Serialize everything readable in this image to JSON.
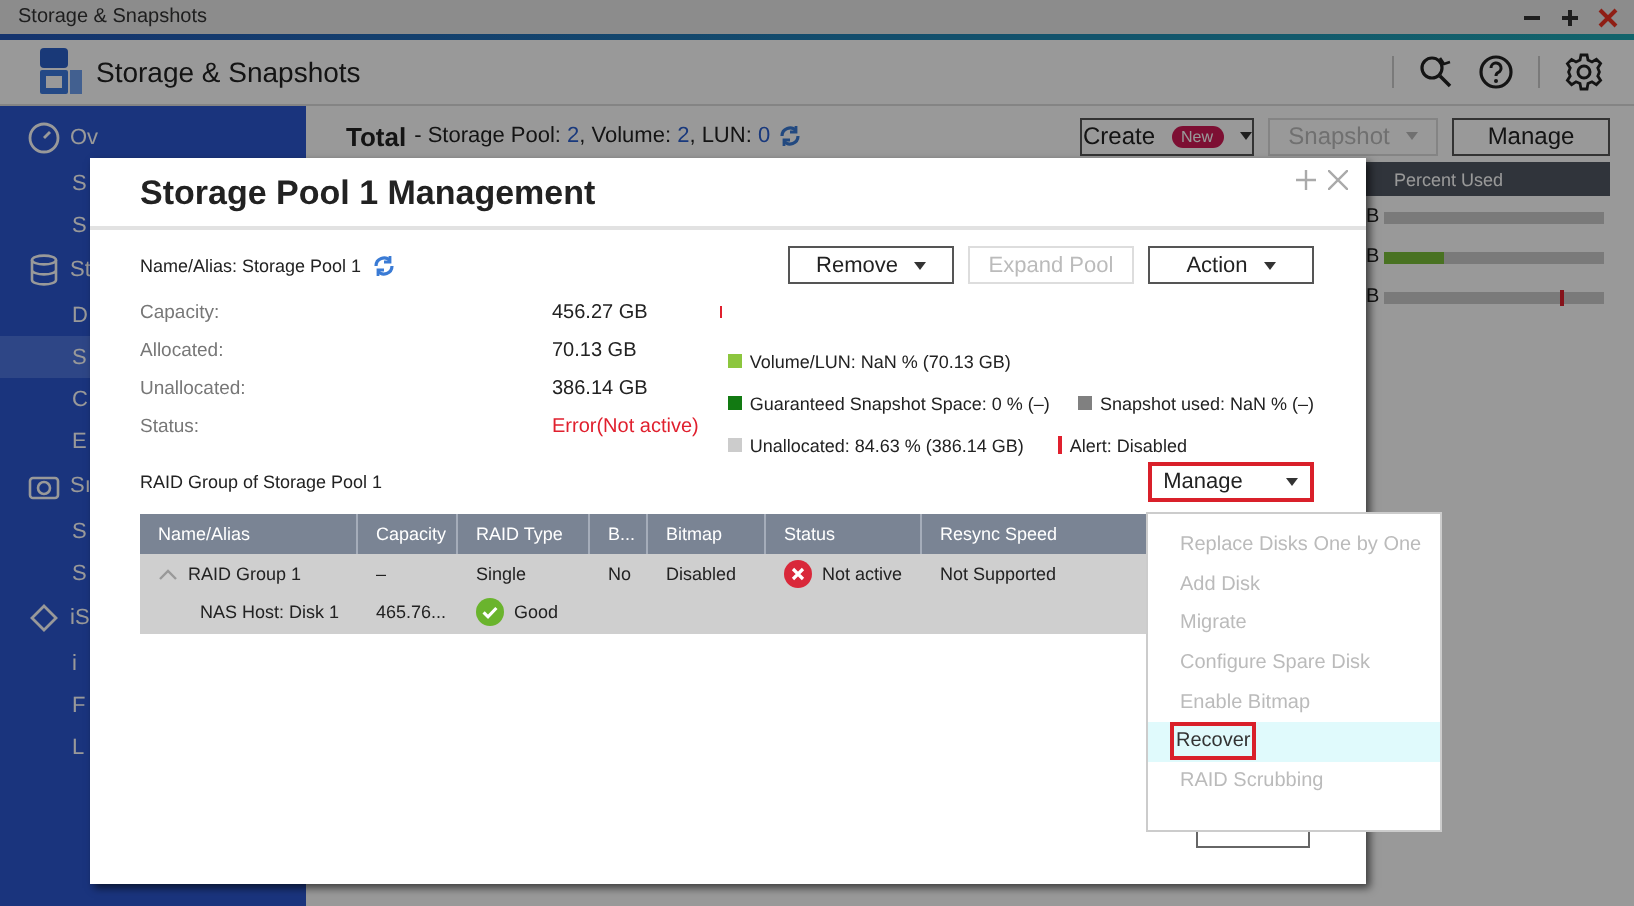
{
  "window": {
    "title": "Storage & Snapshots"
  },
  "app_header": {
    "title": "Storage & Snapshots"
  },
  "sidebar": {
    "items": [
      {
        "label": "Ov",
        "kind": "section",
        "selected": false
      },
      {
        "label": "S",
        "kind": "item",
        "selected": false
      },
      {
        "label": "S",
        "kind": "item",
        "selected": false
      },
      {
        "label": "St",
        "kind": "section",
        "selected": false
      },
      {
        "label": "D",
        "kind": "item",
        "selected": false
      },
      {
        "label": "S",
        "kind": "item",
        "selected": true
      },
      {
        "label": "C",
        "kind": "item",
        "selected": false
      },
      {
        "label": "E",
        "kind": "item",
        "selected": false
      },
      {
        "label": "Sı",
        "kind": "section",
        "selected": false
      },
      {
        "label": "S",
        "kind": "item",
        "selected": false
      },
      {
        "label": "S",
        "kind": "item",
        "selected": false
      },
      {
        "label": "iS",
        "kind": "section",
        "selected": false
      },
      {
        "label": "i",
        "kind": "item",
        "selected": false
      },
      {
        "label": "F",
        "kind": "item",
        "selected": false
      },
      {
        "label": "L",
        "kind": "item",
        "selected": false
      }
    ]
  },
  "toolbar": {
    "total_label": "Total",
    "total_detail": "- Storage Pool: **2**, Volume: **2**, LUN: **0**",
    "buttons": [
      {
        "label": "Create",
        "badge": "New",
        "dropdown": true,
        "disabled": false
      },
      {
        "label": "Snapshot",
        "dropdown": true,
        "disabled": true
      },
      {
        "label": "Manage",
        "dropdown": false,
        "disabled": false
      }
    ]
  },
  "background_table": {
    "columns": [
      "Percent Used"
    ],
    "rows": [
      {
        "cell": "B",
        "level": 0,
        "alert": false
      },
      {
        "cell": "B",
        "level": 0.27,
        "alert": false
      },
      {
        "cell": "B",
        "level": 0,
        "alert": true
      }
    ]
  },
  "dialog": {
    "title": "Storage Pool 1 Management",
    "name_alias": "Name/Alias: Storage Pool 1",
    "buttons": [
      {
        "label": "Remove",
        "dropdown": true,
        "disabled": false
      },
      {
        "label": "Expand Pool",
        "dropdown": false,
        "disabled": true
      },
      {
        "label": "Action",
        "dropdown": true,
        "disabled": false
      }
    ],
    "fields": [
      {
        "label": "Capacity:",
        "value": "456.27 GB",
        "error": false
      },
      {
        "label": "Allocated:",
        "value": "70.13 GB",
        "error": false
      },
      {
        "label": "Unallocated:",
        "value": "386.14 GB",
        "error": false
      },
      {
        "label": "Status:",
        "value": "Error(Not active)",
        "error": true
      }
    ],
    "legend": [
      [
        {
          "kind": "swatch",
          "color": "#8cc63e",
          "label": "Volume/LUN: NaN % (70.13 GB)"
        }
      ],
      [
        {
          "kind": "swatch",
          "color": "#127a12",
          "label": "Guaranteed Snapshot Space: 0 % (–)"
        },
        {
          "kind": "swatch",
          "color": "#808080",
          "label": "Snapshot used: NaN % (–)"
        }
      ],
      [
        {
          "kind": "swatch",
          "color": "#cccccc",
          "label": "Unallocated: 84.63 % (386.14 GB)"
        },
        {
          "kind": "marker",
          "color": "#e0202e",
          "label": "Alert: Disabled"
        }
      ]
    ],
    "raid_title": "RAID Group of Storage Pool 1",
    "manage_button": {
      "label": "Manage",
      "highlighted": true
    },
    "raid_table": {
      "columns": [
        "Name/Alias",
        "Capacity",
        "RAID Type",
        "B...",
        "Bitmap",
        "Status",
        "Resync Speed"
      ],
      "rows": [
        {
          "kind": "group",
          "expanded": true,
          "cells": [
            "RAID Group 1",
            "–",
            "Single",
            "No",
            "Disabled",
            "Not active",
            "Not Supported"
          ],
          "error": true
        },
        {
          "kind": "disk",
          "cells": [
            "NAS Host: Disk 1",
            "465.76...",
            "Good"
          ],
          "error": false
        }
      ]
    }
  },
  "manage_menu": {
    "items": [
      {
        "label": "Replace Disks One by One",
        "disabled": true,
        "selected": false,
        "highlighted": false
      },
      {
        "label": "Add Disk",
        "disabled": true,
        "selected": false,
        "highlighted": false
      },
      {
        "label": "Migrate",
        "disabled": true,
        "selected": false,
        "highlighted": false
      },
      {
        "label": "Configure Spare Disk",
        "disabled": true,
        "selected": false,
        "highlighted": false
      },
      {
        "label": "Enable Bitmap",
        "disabled": true,
        "selected": false,
        "highlighted": false
      },
      {
        "label": "Recover",
        "disabled": false,
        "selected": true,
        "highlighted": true
      },
      {
        "label": "RAID Scrubbing",
        "disabled": true,
        "selected": false,
        "highlighted": false
      }
    ]
  }
}
